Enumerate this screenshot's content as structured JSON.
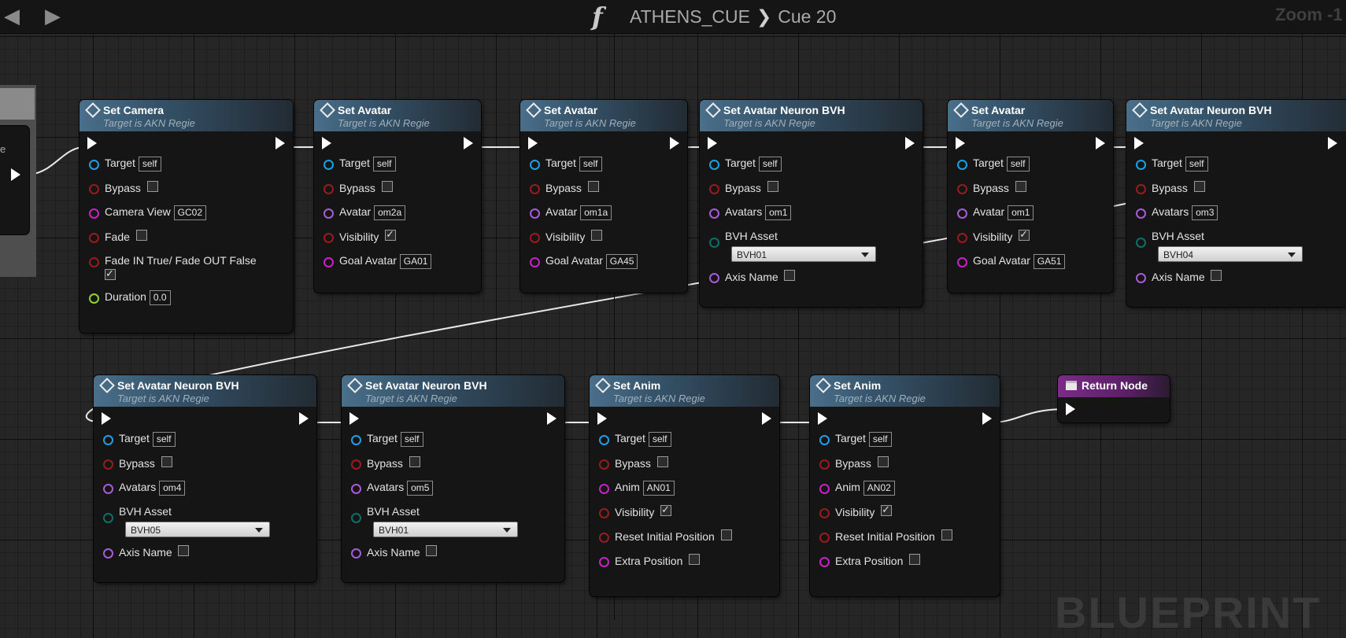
{
  "toolbar": {
    "back_icon": "back-arrow-icon",
    "forward_icon": "forward-arrow-icon",
    "function_icon": "function-f-icon"
  },
  "breadcrumb": {
    "parent": "ATHENS_CUE",
    "current": "Cue 20"
  },
  "zoom_label": "Zoom -1",
  "watermark": "BLUEPRINT",
  "prev_node_label": "e",
  "nodes": {
    "n1": {
      "title": "Set Camera",
      "subtitle": "Target is AKN Regie",
      "pins": {
        "target": "Target",
        "target_val": "self",
        "bypass": "Bypass",
        "camera_view": "Camera View",
        "camera_view_val": "GC02",
        "fade": "Fade",
        "fade_in_out": "Fade IN True/ Fade OUT False",
        "duration": "Duration",
        "duration_val": "0.0"
      },
      "checks": {
        "bypass": false,
        "fade": false,
        "fade_in_out": true
      }
    },
    "n2": {
      "title": "Set Avatar",
      "subtitle": "Target is AKN Regie",
      "pins": {
        "target": "Target",
        "target_val": "self",
        "bypass": "Bypass",
        "avatar": "Avatar",
        "avatar_val": "om2a",
        "visibility": "Visibility",
        "goal": "Goal Avatar",
        "goal_val": "GA01"
      },
      "checks": {
        "bypass": false,
        "visibility": true
      }
    },
    "n3": {
      "title": "Set Avatar",
      "subtitle": "Target is AKN Regie",
      "pins": {
        "target": "Target",
        "target_val": "self",
        "bypass": "Bypass",
        "avatar": "Avatar",
        "avatar_val": "om1a",
        "visibility": "Visibility",
        "goal": "Goal Avatar",
        "goal_val": "GA45"
      },
      "checks": {
        "bypass": false,
        "visibility": false
      }
    },
    "n4": {
      "title": "Set Avatar Neuron BVH",
      "subtitle": "Target is AKN Regie",
      "pins": {
        "target": "Target",
        "target_val": "self",
        "bypass": "Bypass",
        "avatars": "Avatars",
        "avatars_val": "om1",
        "bvh_asset": "BVH Asset",
        "bvh_val": "BVH01",
        "axis": "Axis Name"
      },
      "checks": {
        "bypass": false,
        "axis": false
      }
    },
    "n5": {
      "title": "Set Avatar",
      "subtitle": "Target is AKN Regie",
      "pins": {
        "target": "Target",
        "target_val": "self",
        "bypass": "Bypass",
        "avatar": "Avatar",
        "avatar_val": "om1",
        "visibility": "Visibility",
        "goal": "Goal Avatar",
        "goal_val": "GA51"
      },
      "checks": {
        "bypass": false,
        "visibility": true
      }
    },
    "n6": {
      "title": "Set Avatar Neuron BVH",
      "subtitle": "Target is AKN Regie",
      "pins": {
        "target": "Target",
        "target_val": "self",
        "bypass": "Bypass",
        "avatars": "Avatars",
        "avatars_val": "om3",
        "bvh_asset": "BVH Asset",
        "bvh_val": "BVH04",
        "axis": "Axis Name"
      },
      "checks": {
        "bypass": false,
        "axis": false
      }
    },
    "n7": {
      "title": "Set Avatar Neuron BVH",
      "subtitle": "Target is AKN Regie",
      "pins": {
        "target": "Target",
        "target_val": "self",
        "bypass": "Bypass",
        "avatars": "Avatars",
        "avatars_val": "om4",
        "bvh_asset": "BVH Asset",
        "bvh_val": "BVH05",
        "axis": "Axis Name"
      },
      "checks": {
        "bypass": false,
        "axis": false
      }
    },
    "n8": {
      "title": "Set Avatar Neuron BVH",
      "subtitle": "Target is AKN Regie",
      "pins": {
        "target": "Target",
        "target_val": "self",
        "bypass": "Bypass",
        "avatars": "Avatars",
        "avatars_val": "om5",
        "bvh_asset": "BVH Asset",
        "bvh_val": "BVH01",
        "axis": "Axis Name"
      },
      "checks": {
        "bypass": false,
        "axis": false
      }
    },
    "n9": {
      "title": "Set Anim",
      "subtitle": "Target is AKN Regie",
      "pins": {
        "target": "Target",
        "target_val": "self",
        "bypass": "Bypass",
        "anim": "Anim",
        "anim_val": "AN01",
        "visibility": "Visibility",
        "reset": "Reset Initial Position",
        "extra": "Extra Position"
      },
      "checks": {
        "bypass": false,
        "visibility": true,
        "reset": false,
        "extra": false
      }
    },
    "n10": {
      "title": "Set Anim",
      "subtitle": "Target is AKN Regie",
      "pins": {
        "target": "Target",
        "target_val": "self",
        "bypass": "Bypass",
        "anim": "Anim",
        "anim_val": "AN02",
        "visibility": "Visibility",
        "reset": "Reset Initial Position",
        "extra": "Extra Position"
      },
      "checks": {
        "bypass": false,
        "visibility": true,
        "reset": false,
        "extra": false
      }
    },
    "ret": {
      "title": "Return Node"
    }
  },
  "colors": {
    "exec_wire": "#ffffff",
    "target_pin": "#1d9fe5",
    "bool_pin": "#9a1b1b",
    "name_pin": "#c622c6",
    "object_pin": "#a95ad8",
    "asset_pin": "#0f6e68",
    "float_pin": "#93d431"
  }
}
